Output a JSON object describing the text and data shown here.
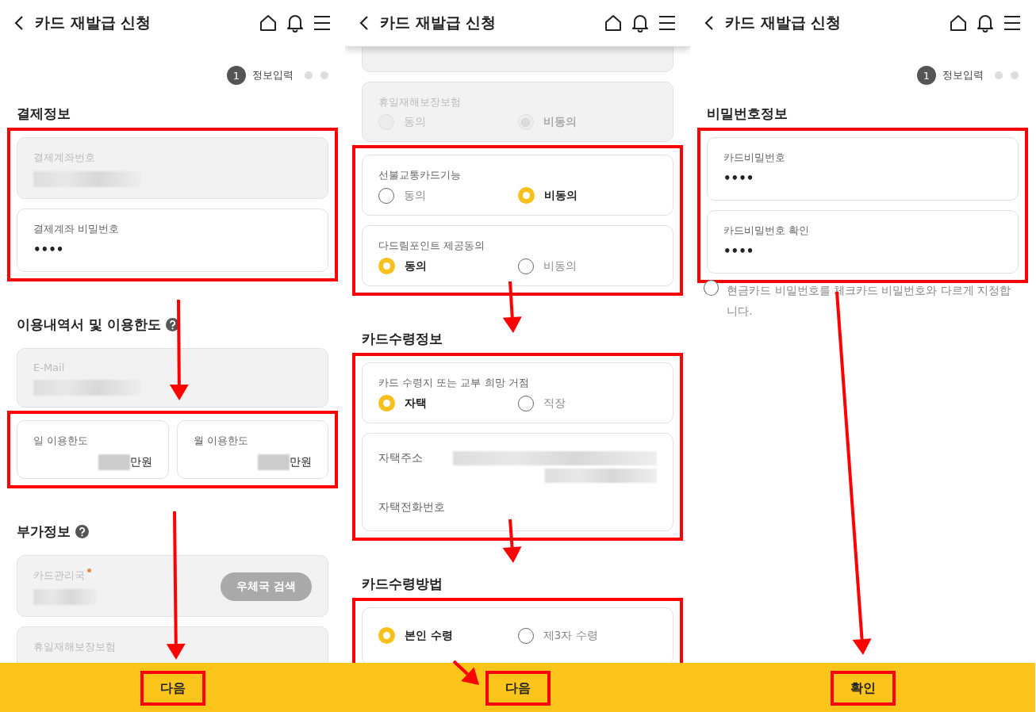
{
  "screens": [
    {
      "header": {
        "title": "카드 재발급 신청",
        "shadow": false
      },
      "steps": [
        {
          "number": "1",
          "label": "정보입력",
          "current": true
        },
        {
          "current": false
        },
        {
          "current": false
        }
      ],
      "sections": [
        {
          "title": "결제정보",
          "groups": [
            {
              "highlighted": true,
              "items": [
                {
                  "kind": "field",
                  "label": "결제계좌번호",
                  "disabled": true,
                  "redacted": true
                },
                {
                  "kind": "field",
                  "label": "결제계좌 비밀번호",
                  "disabled": false,
                  "value": "••••"
                }
              ]
            }
          ]
        },
        {
          "title": "이용내역서 및 이용한도",
          "help": true,
          "groups": [
            {
              "items": [
                {
                  "kind": "field",
                  "label": "E-Mail",
                  "disabled": true,
                  "redacted": true
                }
              ]
            },
            {
              "highlighted": true,
              "items": [
                {
                  "kind": "limits",
                  "cells": [
                    {
                      "label": "일 이용한도",
                      "unit": "만원"
                    },
                    {
                      "label": "월 이용한도",
                      "unit": "만원"
                    }
                  ]
                }
              ]
            }
          ]
        },
        {
          "title": "부가정보",
          "help": true,
          "groups": [
            {
              "items": [
                {
                  "kind": "search",
                  "label": "카드관리국",
                  "required": true,
                  "disabled": true,
                  "redacted": true,
                  "button": "우체국 검색"
                },
                {
                  "kind": "radio",
                  "label": "휴일재해보장보험",
                  "disabled": true
                }
              ]
            }
          ]
        }
      ],
      "footer_button": {
        "label": "다음",
        "highlighted": true
      }
    },
    {
      "header": {
        "title": "카드 재발급 신청",
        "shadow": true
      },
      "sections": [
        {
          "groups": [
            {
              "items": [
                {
                  "kind": "clipped"
                },
                {
                  "kind": "radio",
                  "label": "휴일재해보장보험",
                  "disabled": true,
                  "options": [
                    {
                      "label": "동의",
                      "selected": false
                    },
                    {
                      "label": "비동의",
                      "selected": true
                    }
                  ]
                }
              ]
            },
            {
              "highlighted": true,
              "items": [
                {
                  "kind": "radio",
                  "label": "선불교통카드기능",
                  "disabled": false,
                  "options": [
                    {
                      "label": "동의",
                      "selected": false
                    },
                    {
                      "label": "비동의",
                      "selected": true
                    }
                  ]
                },
                {
                  "kind": "radio",
                  "label": "다드림포인트 제공동의",
                  "disabled": false,
                  "options": [
                    {
                      "label": "동의",
                      "selected": true
                    },
                    {
                      "label": "비동의",
                      "selected": false
                    }
                  ]
                }
              ]
            }
          ]
        },
        {
          "title": "카드수령정보",
          "groups": [
            {
              "highlighted": true,
              "items": [
                {
                  "kind": "radio",
                  "label": "카드 수령지 또는 교부 희망 거점",
                  "disabled": false,
                  "options": [
                    {
                      "label": "자택",
                      "selected": true
                    },
                    {
                      "label": "직장",
                      "selected": false
                    }
                  ]
                },
                {
                  "kind": "address",
                  "rows": [
                    {
                      "label": "자택주소",
                      "redacted": true
                    },
                    {
                      "label": "자택전화번호"
                    }
                  ]
                }
              ]
            }
          ]
        },
        {
          "title": "카드수령방법",
          "groups": [
            {
              "highlighted": true,
              "items": [
                {
                  "kind": "radio",
                  "disabled": false,
                  "options": [
                    {
                      "label": "본인 수령",
                      "selected": true
                    },
                    {
                      "label": "제3자 수령",
                      "selected": false
                    }
                  ]
                }
              ]
            }
          ]
        }
      ],
      "footer_button": {
        "label": "다음",
        "highlighted": true
      }
    },
    {
      "header": {
        "title": "카드 재발급 신청",
        "shadow": false
      },
      "steps": [
        {
          "number": "1",
          "label": "정보입력",
          "current": true
        },
        {
          "current": false
        },
        {
          "current": false
        }
      ],
      "sections": [
        {
          "title": "비밀번호정보",
          "groups": [
            {
              "highlighted": true,
              "items": [
                {
                  "kind": "field",
                  "label": "카드비밀번호",
                  "disabled": false,
                  "value": "••••"
                },
                {
                  "kind": "field",
                  "label": "카드비밀번호 확인",
                  "disabled": false,
                  "value": "••••"
                }
              ]
            },
            {
              "items": [
                {
                  "kind": "checkbox",
                  "label": "현금카드 비밀번호를 체크카드 비밀번호와 다르게 지정합니다.",
                  "checked": false
                }
              ]
            }
          ]
        }
      ],
      "footer_button": {
        "label": "확인",
        "highlighted": true
      }
    }
  ]
}
